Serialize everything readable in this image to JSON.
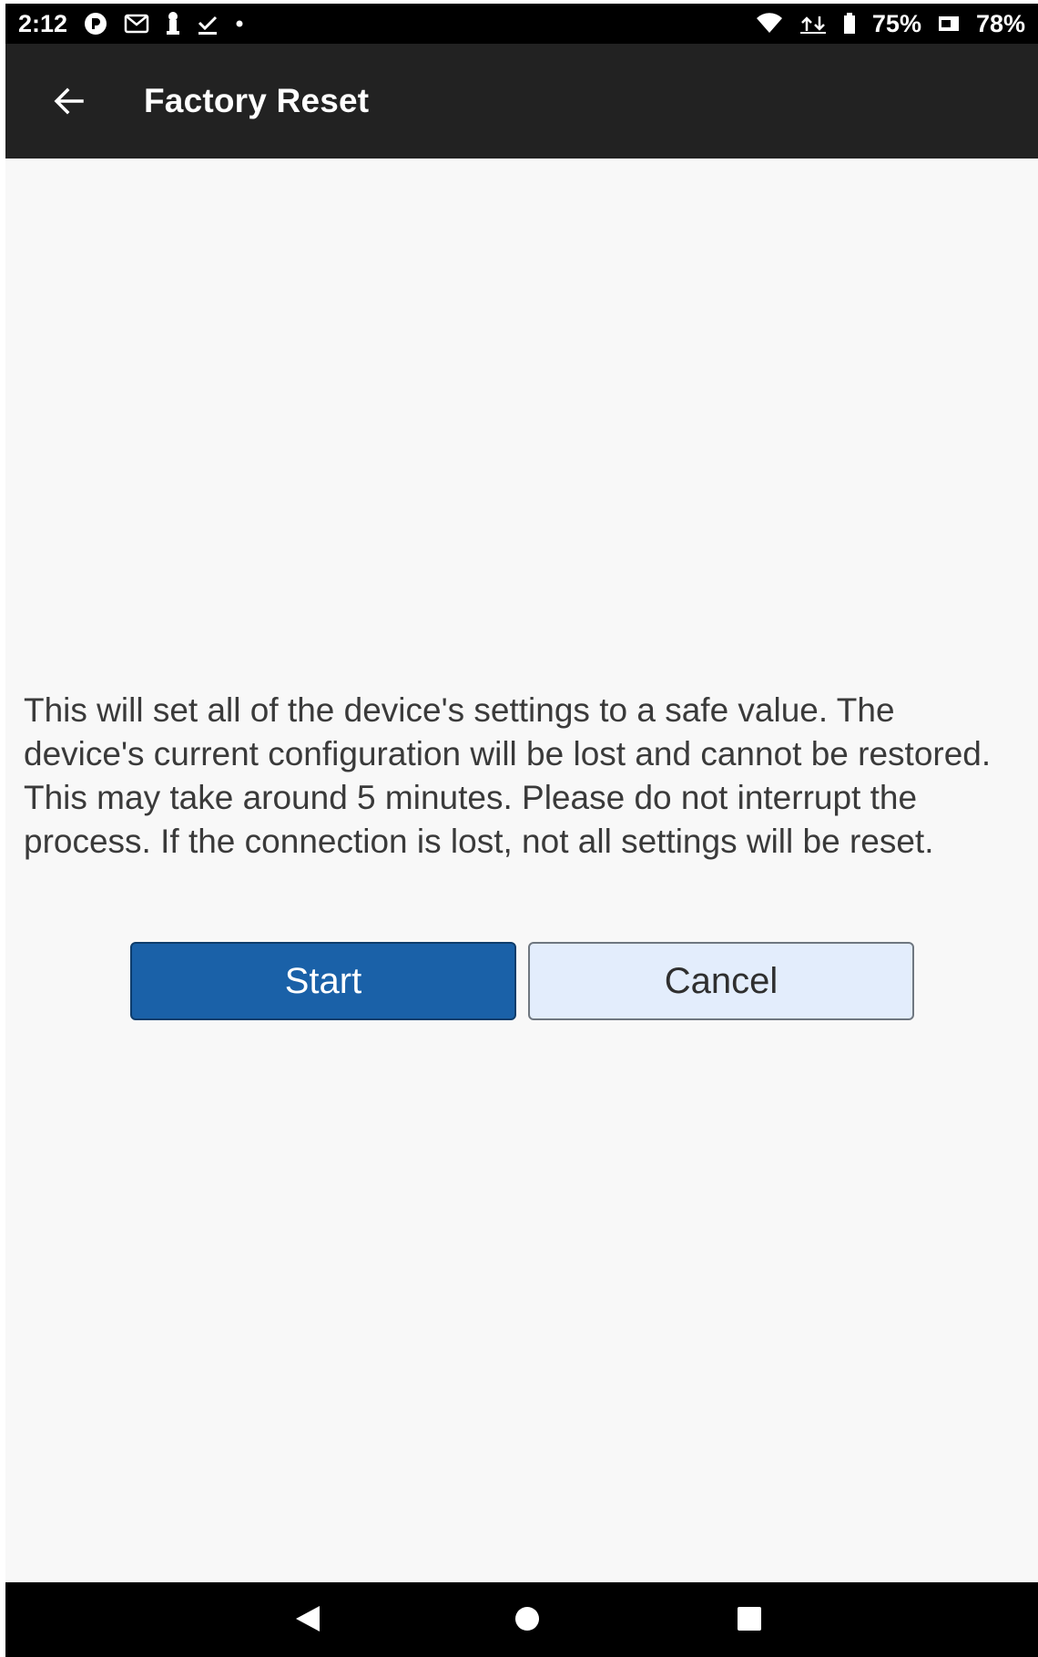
{
  "status_bar": {
    "time": "2:12",
    "left_icons": [
      "vpn-icon",
      "gmail-icon",
      "keyhole-icon",
      "download-done-icon",
      "dot-icon"
    ],
    "right_icons": [
      "wifi-icon",
      "data-transfer-icon"
    ],
    "battery1": "75%",
    "battery2": "78%"
  },
  "app_bar": {
    "title": "Factory Reset",
    "back_icon": "arrow-back-icon"
  },
  "main": {
    "message": "This will set all of the device's settings to a safe value. The device's current configuration will be lost and cannot be restored. This may take around 5 minutes. Please do not interrupt the process. If the connection is lost, not all settings will be reset.",
    "start_label": "Start",
    "cancel_label": "Cancel"
  },
  "nav_bar": {
    "icons": [
      "nav-back-icon",
      "nav-home-icon",
      "nav-recents-icon"
    ]
  },
  "colors": {
    "app_bar": "#222222",
    "primary_button": "#1a61a8",
    "secondary_button": "#e3edfc",
    "background": "#f8f8f8"
  }
}
